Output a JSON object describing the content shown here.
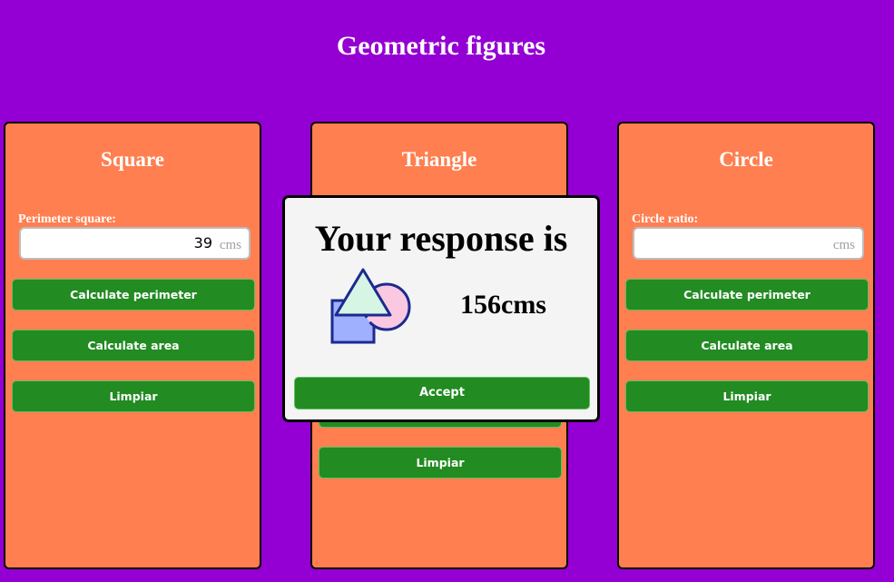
{
  "page": {
    "title": "Geometric figures"
  },
  "cards": {
    "square": {
      "title": "Square",
      "field_label": "Perimeter square:",
      "field_value": "39",
      "field_unit": "cms",
      "btn_perimeter": "Calculate perimeter",
      "btn_area": "Calculate area",
      "btn_clear": "Limpiar"
    },
    "triangle": {
      "title": "Triangle",
      "btn_clear": "Limpiar"
    },
    "circle": {
      "title": "Circle",
      "field_label": "Circle ratio:",
      "field_value": "",
      "field_unit": "cms",
      "btn_perimeter": "Calculate perimeter",
      "btn_area": "Calculate area",
      "btn_clear": "Limpiar"
    }
  },
  "modal": {
    "title": "Your response is",
    "result": "156cms",
    "icon": "geometric-shapes-icon",
    "accept_label": "Accept"
  },
  "colors": {
    "background": "#9400d3",
    "card": "#ff7f50",
    "button": "#228b22",
    "modal": "#f4f4f4"
  }
}
